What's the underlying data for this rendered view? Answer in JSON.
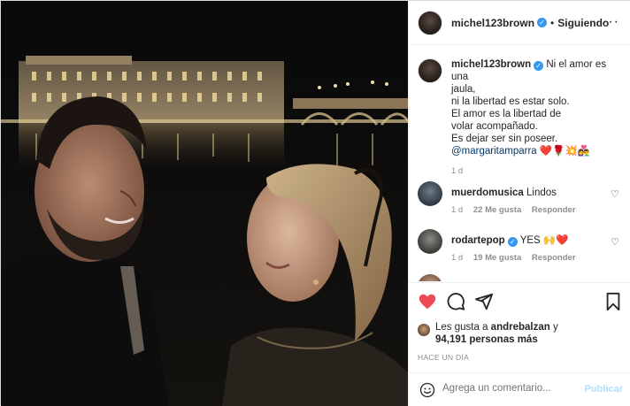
{
  "header": {
    "username": "michel123brown",
    "verified_mark": "✓",
    "separator": "•",
    "follow_label": "Siguiendo",
    "more_icon": "more-horizontal-icon"
  },
  "caption": {
    "username": "michel123brown",
    "lines": [
      "Ni el amor es una",
      "jaula,",
      "ni la libertad es estar solo.",
      "El amor es la libertad de",
      "volar acompañado.",
      "Es dejar ser sin poseer."
    ],
    "mention": "@margaritamparra",
    "emojis": "❤️🌹💥👩‍❤️‍👨",
    "time": "1 d"
  },
  "comments": [
    {
      "username": "muerdomusica",
      "text": "Lindos",
      "verified": false,
      "time": "1 d",
      "likes": "22 Me gusta",
      "reply": "Responder"
    },
    {
      "username": "rodartepop",
      "text": "YES 🙌❤️",
      "verified": true,
      "time": "1 d",
      "likes": "19 Me gusta",
      "reply": "Responder"
    }
  ],
  "likes": {
    "prefix": "Les gusta a",
    "user": "andrebalzan",
    "connector": "y",
    "count": "94,191 personas más"
  },
  "posted": "HACE UN DÍA",
  "add_comment": {
    "placeholder": "Agrega un comentario...",
    "publish_label": "Publicar"
  },
  "colors": {
    "like": "#ed4956",
    "verified": "#3897f0",
    "publish_disabled": "#b2dffc",
    "mention": "#00376b"
  }
}
